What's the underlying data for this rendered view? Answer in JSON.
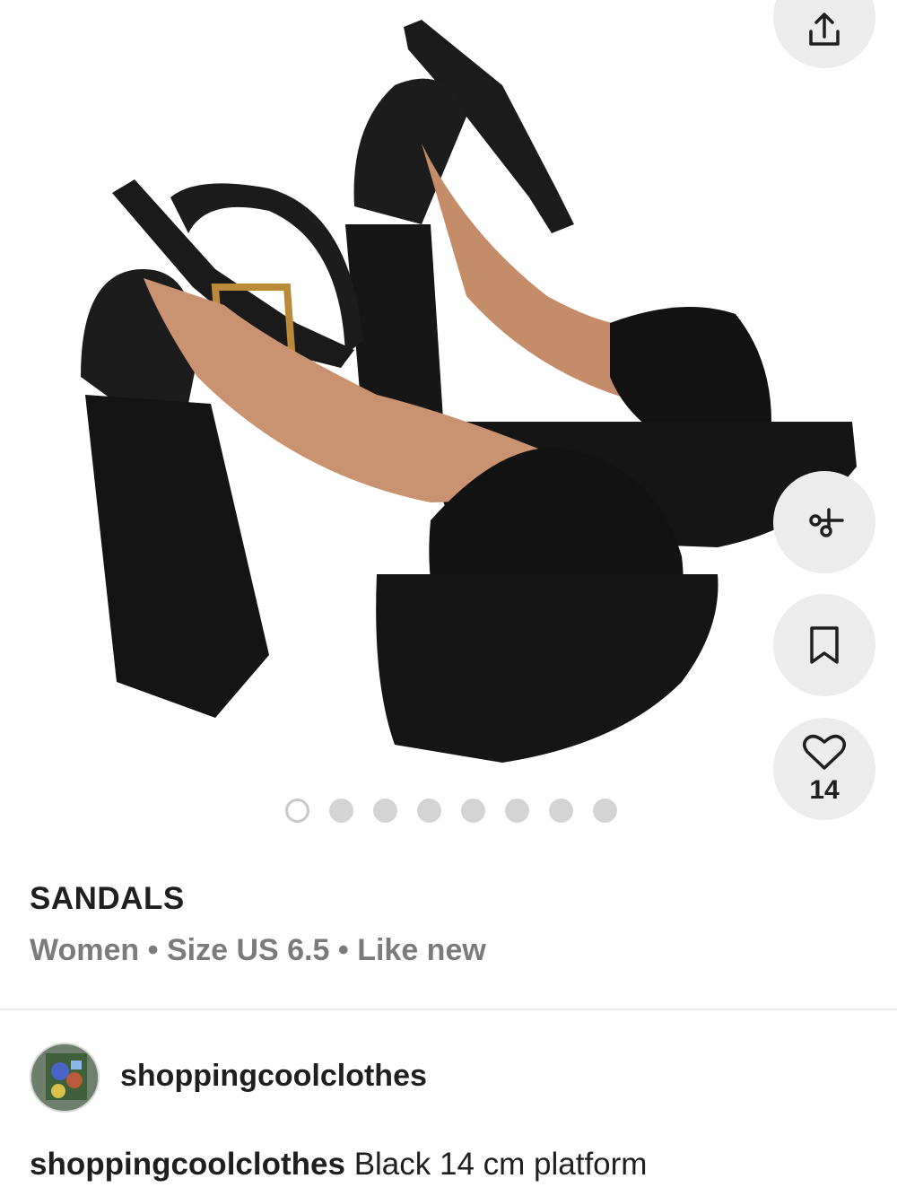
{
  "listing": {
    "image_dots_total": 8,
    "active_image": 1,
    "likes": "14",
    "category": "SANDALS",
    "gender": "Women",
    "size": "Size US 6.5",
    "condition": "Like new",
    "separator": "•"
  },
  "seller": {
    "username": "shoppingcoolclothes"
  },
  "description": {
    "username": "shoppingcoolclothes",
    "text": "Black 14 cm platform"
  },
  "icons": {
    "share": "share-icon",
    "size_compare": "scissors-icon",
    "save": "bookmark-icon",
    "like": "heart-icon"
  }
}
